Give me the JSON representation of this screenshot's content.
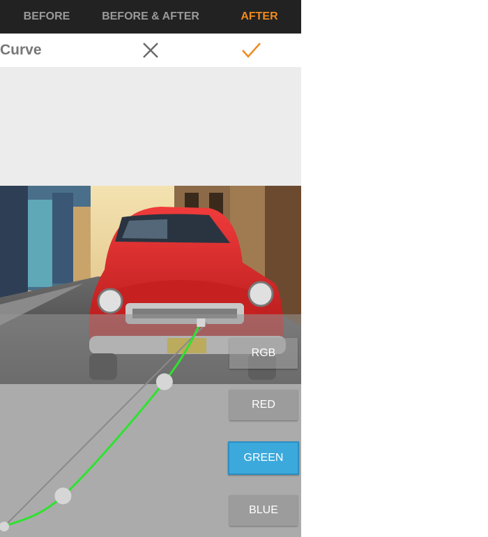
{
  "view_tabs": {
    "before": "BEFORE",
    "before_after": "BEFORE & AFTER",
    "after": "AFTER",
    "active": "after"
  },
  "actionbar": {
    "title": "Curve",
    "cancel_icon": "close-icon",
    "confirm_icon": "check-icon"
  },
  "channels": {
    "rgb": "RGB",
    "red": "RED",
    "green": "GREEN",
    "blue": "BLUE",
    "selected": "green"
  },
  "curve": {
    "control_points": [
      {
        "input": 0,
        "output": 0
      },
      {
        "input": 0.29,
        "output": 0.15
      },
      {
        "input": 0.79,
        "output": 0.71
      },
      {
        "input": 0.97,
        "output": 1
      }
    ]
  },
  "colors": {
    "accent": "#f08a1e",
    "selected_channel": "#3ba9dc",
    "curve": "#2fe22f",
    "reference_line": "#8a8a8a"
  }
}
